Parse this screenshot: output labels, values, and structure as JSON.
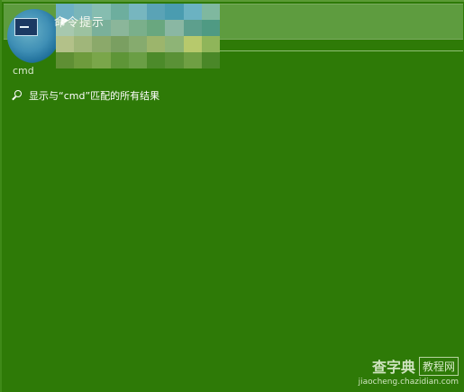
{
  "best_match": {
    "subtitle": "命令提示",
    "app_name": "cmd"
  },
  "search_all": {
    "prefix": "显示与“",
    "query": "cmd",
    "suffix": "”匹配的所有结果"
  },
  "watermark": {
    "brand": "查字典",
    "tag": "教程网",
    "url": "jiaocheng.chazidian.com"
  },
  "colors": {
    "background": "#2e7a07",
    "highlight": "#5e9c3f",
    "text": "#ffffff"
  },
  "icons": {
    "app": "command-prompt-icon",
    "search": "search-icon"
  }
}
